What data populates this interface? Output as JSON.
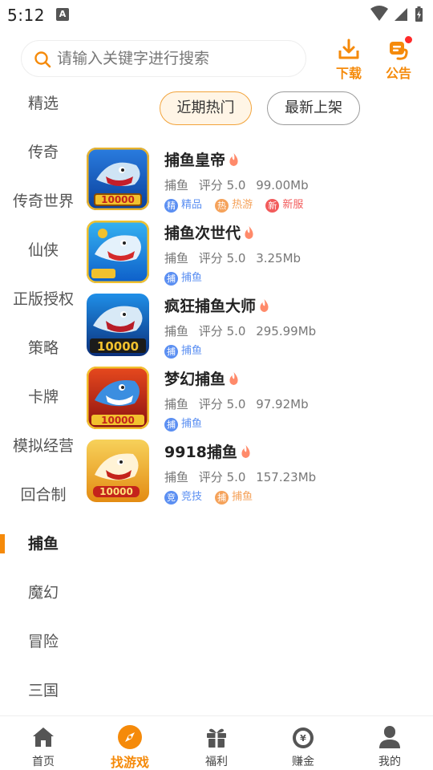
{
  "status": {
    "time": "5:12",
    "notif_letter": "A"
  },
  "search": {
    "placeholder": "请输入关键字进行搜索"
  },
  "header": {
    "download_label": "下载",
    "notice_label": "公告"
  },
  "categories": [
    "精选",
    "传奇",
    "传奇世界",
    "仙侠",
    "正版授权",
    "策略",
    "卡牌",
    "模拟经营",
    "回合制",
    "捕鱼",
    "魔幻",
    "冒险",
    "三国"
  ],
  "active_category": "捕鱼",
  "tabs": {
    "hot": "近期热门",
    "new": "最新上架",
    "active": "hot"
  },
  "games": [
    {
      "name": "捕鱼皇帝",
      "genre": "捕鱼",
      "rating": "评分 5.0",
      "size": "99.00Mb",
      "tags": [
        {
          "icon": "精",
          "label": "精品",
          "color": "#5b8ff2"
        },
        {
          "icon": "热",
          "label": "热游",
          "color": "#f5a25a"
        },
        {
          "icon": "新",
          "label": "新服",
          "color": "#f25b5b"
        }
      ]
    },
    {
      "name": "捕鱼次世代",
      "genre": "捕鱼",
      "rating": "评分 5.0",
      "size": "3.25Mb",
      "tags": [
        {
          "icon": "捕",
          "label": "捕鱼",
          "color": "#5b8ff2"
        }
      ]
    },
    {
      "name": "疯狂捕鱼大师",
      "genre": "捕鱼",
      "rating": "评分 5.0",
      "size": "295.99Mb",
      "tags": [
        {
          "icon": "捕",
          "label": "捕鱼",
          "color": "#5b8ff2"
        }
      ]
    },
    {
      "name": "梦幻捕鱼",
      "genre": "捕鱼",
      "rating": "评分 5.0",
      "size": "97.92Mb",
      "tags": [
        {
          "icon": "捕",
          "label": "捕鱼",
          "color": "#5b8ff2"
        }
      ]
    },
    {
      "name": "9918捕鱼",
      "genre": "捕鱼",
      "rating": "评分 5.0",
      "size": "157.23Mb",
      "tags": [
        {
          "icon": "竞",
          "label": "竞技",
          "color": "#5b8ff2"
        },
        {
          "icon": "捕",
          "label": "捕鱼",
          "color": "#f5a25a"
        }
      ]
    }
  ],
  "nav": [
    {
      "label": "首页",
      "icon": "home-icon"
    },
    {
      "label": "找游戏",
      "icon": "compass-icon",
      "active": true
    },
    {
      "label": "福利",
      "icon": "gift-icon"
    },
    {
      "label": "赚金",
      "icon": "money-bag-icon"
    },
    {
      "label": "我的",
      "icon": "profile-icon"
    }
  ],
  "colors": {
    "accent": "#f58a0a",
    "tab_active_border": "#f2a33a",
    "tab_active_bg": "#fff5e6"
  }
}
